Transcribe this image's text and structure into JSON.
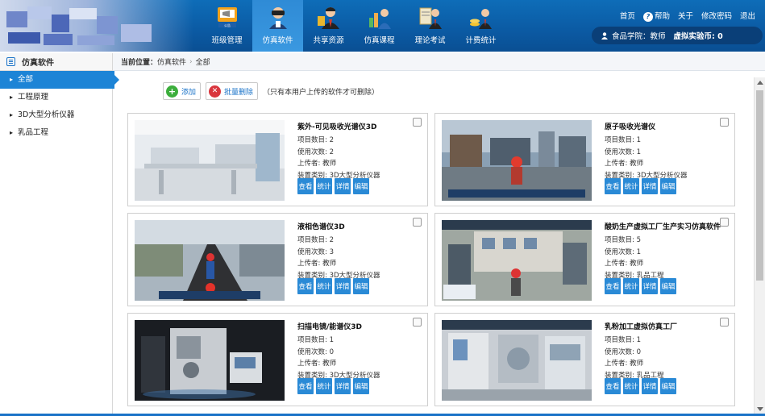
{
  "header": {
    "nav": [
      {
        "label": "班级管理",
        "icon": "announcement-icon",
        "active": false
      },
      {
        "label": "仿真软件",
        "icon": "vr-headset-icon",
        "active": true
      },
      {
        "label": "共享资源",
        "icon": "teacher-icon",
        "active": false
      },
      {
        "label": "仿真课程",
        "icon": "bar-chart-person-icon",
        "active": false
      },
      {
        "label": "理论考试",
        "icon": "exam-person-icon",
        "active": false
      },
      {
        "label": "计费统计",
        "icon": "coins-person-icon",
        "active": false
      }
    ],
    "top_links": {
      "home": "首页",
      "help": "帮助",
      "about": "关于",
      "change_password": "修改密码",
      "logout": "退出"
    },
    "user": {
      "text": "食品学院：教师",
      "coins": "虚拟实验币: 0"
    }
  },
  "sidebar": {
    "title": "仿真软件",
    "items": [
      {
        "label": "全部",
        "active": true
      },
      {
        "label": "工程原理",
        "active": false
      },
      {
        "label": "3D大型分析仪器",
        "active": false
      },
      {
        "label": "乳品工程",
        "active": false
      }
    ]
  },
  "breadcrumb": {
    "label": "当前位置：",
    "items": [
      "仿真软件",
      "全部"
    ]
  },
  "toolbar": {
    "add": "添加",
    "batch_delete": "批量删除",
    "note": "（只有本用户上传的软件才可删除）"
  },
  "card_labels": {
    "count": "项目数目: ",
    "usage": "使用次数: ",
    "uploader": "上传者: ",
    "category": "装置类别: "
  },
  "card_buttons": {
    "view": "查看",
    "stats": "统计",
    "detail": "详情",
    "edit": "编辑"
  },
  "cards": [
    {
      "title": "紫外-可见吸收光谱仪3D",
      "count": "2",
      "usage": "2",
      "uploader": "教师",
      "category": "3D大型分析仪器"
    },
    {
      "title": "原子吸收光谱仪",
      "count": "1",
      "usage": "1",
      "uploader": "教师",
      "category": "3D大型分析仪器"
    },
    {
      "title": "液相色谱仪3D",
      "count": "2",
      "usage": "3",
      "uploader": "教师",
      "category": "3D大型分析仪器"
    },
    {
      "title": "酸奶生产虚拟工厂生产实习仿真软件",
      "count": "5",
      "usage": "1",
      "uploader": "教师",
      "category": "乳品工程"
    },
    {
      "title": "扫描电镜/能谱仪3D",
      "count": "1",
      "usage": "0",
      "uploader": "教师",
      "category": "3D大型分析仪器"
    },
    {
      "title": "乳粉加工虚拟仿真工厂",
      "count": "1",
      "usage": "0",
      "uploader": "教师",
      "category": "乳品工程"
    }
  ]
}
